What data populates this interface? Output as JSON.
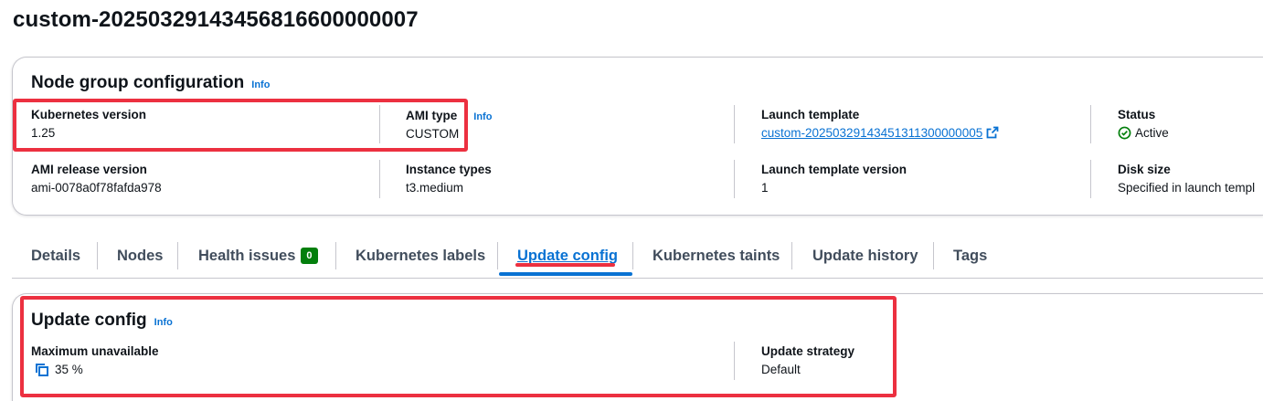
{
  "page": {
    "title": "custom-20250329143456816600000007"
  },
  "node_group_config": {
    "title": "Node group configuration",
    "info_label": "Info",
    "fields": {
      "kubernetes_version": {
        "label": "Kubernetes version",
        "value": "1.25"
      },
      "ami_type": {
        "label": "AMI type",
        "value": "CUSTOM",
        "info_label": "Info"
      },
      "launch_template": {
        "label": "Launch template",
        "value": "custom-20250329143451311300000005"
      },
      "status": {
        "label": "Status",
        "value": "Active"
      },
      "ami_release_version": {
        "label": "AMI release version",
        "value": "ami-0078a0f78fafda978"
      },
      "instance_types": {
        "label": "Instance types",
        "value": "t3.medium"
      },
      "launch_template_version": {
        "label": "Launch template version",
        "value": "1"
      },
      "disk_size": {
        "label": "Disk size",
        "value": "Specified in launch templ"
      }
    }
  },
  "tabs": [
    {
      "label": "Details"
    },
    {
      "label": "Nodes"
    },
    {
      "label": "Health issues",
      "badge": "0"
    },
    {
      "label": "Kubernetes labels"
    },
    {
      "label": "Update config",
      "active": true
    },
    {
      "label": "Kubernetes taints"
    },
    {
      "label": "Update history"
    },
    {
      "label": "Tags"
    }
  ],
  "update_config": {
    "title": "Update config",
    "info_label": "Info",
    "maximum_unavailable": {
      "label": "Maximum unavailable",
      "value": "35 %"
    },
    "update_strategy": {
      "label": "Update strategy",
      "value": "Default"
    }
  },
  "colors": {
    "link": "#0972d3",
    "success": "#037f0c",
    "highlight_annotation": "#ec3040",
    "border": "#c6c6cd"
  },
  "icons": {
    "external_link": "external-link-icon",
    "status_ok": "check-circle-icon",
    "copy": "copy-icon"
  }
}
